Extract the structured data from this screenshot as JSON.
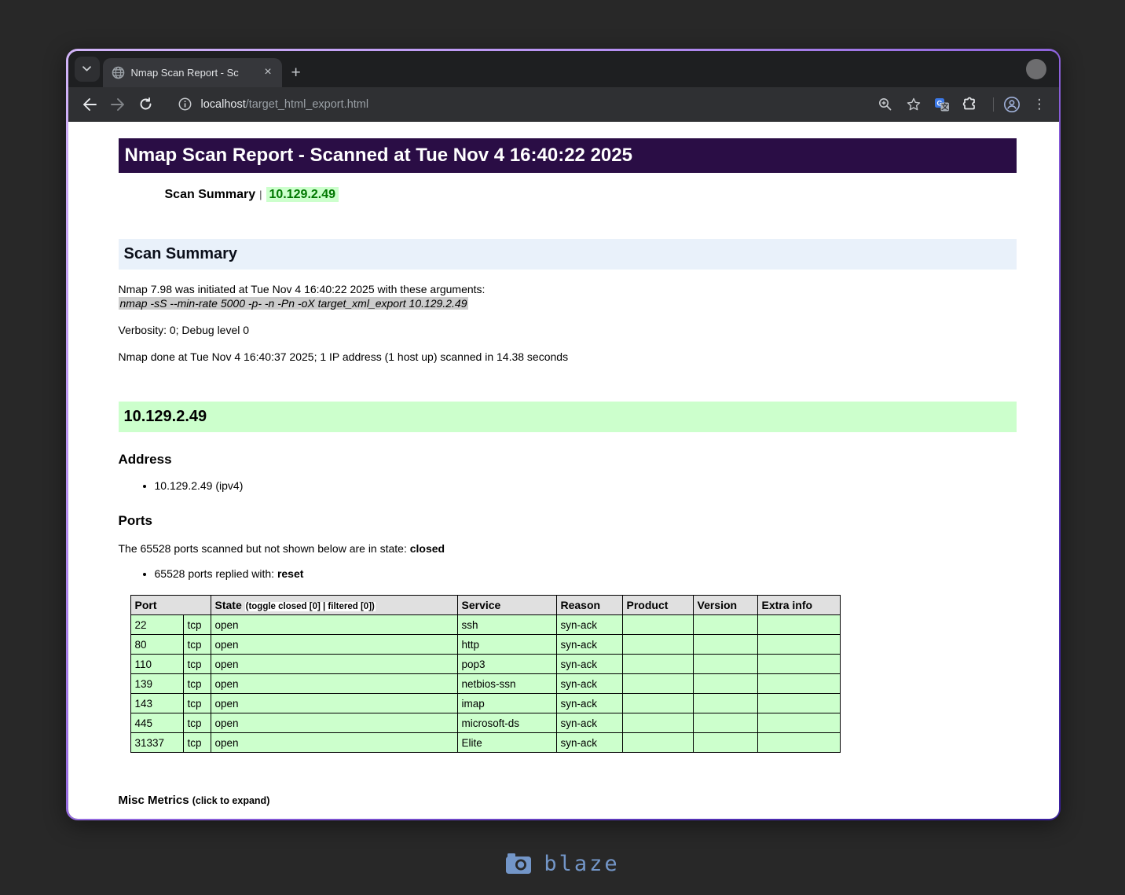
{
  "browser": {
    "tab": {
      "title": "Nmap Scan Report - Sc",
      "close_glyph": "×",
      "new_tab_glyph": "+",
      "kebab_glyph": "⋮"
    },
    "url": {
      "host": "localhost",
      "path": "/target_html_export.html"
    }
  },
  "report": {
    "title": "Nmap Scan Report - Scanned at Tue Nov 4 16:40:22 2025",
    "nav": {
      "summary_link": "Scan Summary",
      "separator": "|",
      "host_link": "10.129.2.49"
    },
    "scan_summary": {
      "heading": "Scan Summary",
      "initiated_line": "Nmap 7.98 was initiated at Tue Nov 4 16:40:22 2025 with these arguments:",
      "command": "nmap -sS --min-rate 5000 -p- -n -Pn -oX target_xml_export 10.129.2.49",
      "verbosity_line": "Verbosity: 0; Debug level 0",
      "done_line": "Nmap done at Tue Nov 4 16:40:37 2025; 1 IP address (1 host up) scanned in 14.38 seconds"
    },
    "host": {
      "heading": "10.129.2.49",
      "address_heading": "Address",
      "addresses": [
        "10.129.2.49 (ipv4)"
      ],
      "ports_heading": "Ports",
      "ports_note_prefix": "The 65528 ports scanned but not shown below are in state: ",
      "ports_note_state": "closed",
      "ports_replied_prefix": "65528 ports replied with: ",
      "ports_replied_value": "reset",
      "table": {
        "headers": {
          "port": "Port",
          "state": "State",
          "state_toggle": "(toggle closed [0] | filtered [0])",
          "service": "Service",
          "reason": "Reason",
          "product": "Product",
          "version": "Version",
          "extra_info": "Extra info"
        },
        "rows": [
          {
            "port": "22",
            "protocol": "tcp",
            "state": "open",
            "service": "ssh",
            "reason": "syn-ack",
            "product": "",
            "version": "",
            "extra": ""
          },
          {
            "port": "80",
            "protocol": "tcp",
            "state": "open",
            "service": "http",
            "reason": "syn-ack",
            "product": "",
            "version": "",
            "extra": ""
          },
          {
            "port": "110",
            "protocol": "tcp",
            "state": "open",
            "service": "pop3",
            "reason": "syn-ack",
            "product": "",
            "version": "",
            "extra": ""
          },
          {
            "port": "139",
            "protocol": "tcp",
            "state": "open",
            "service": "netbios-ssn",
            "reason": "syn-ack",
            "product": "",
            "version": "",
            "extra": ""
          },
          {
            "port": "143",
            "protocol": "tcp",
            "state": "open",
            "service": "imap",
            "reason": "syn-ack",
            "product": "",
            "version": "",
            "extra": ""
          },
          {
            "port": "445",
            "protocol": "tcp",
            "state": "open",
            "service": "microsoft-ds",
            "reason": "syn-ack",
            "product": "",
            "version": "",
            "extra": ""
          },
          {
            "port": "31337",
            "protocol": "tcp",
            "state": "open",
            "service": "Elite",
            "reason": "syn-ack",
            "product": "",
            "version": "",
            "extra": ""
          }
        ]
      },
      "misc_metrics_label": "Misc Metrics",
      "misc_metrics_hint": "(click to expand)"
    }
  },
  "watermark": {
    "label": "blaze"
  },
  "colors": {
    "header_purple": "#2A0D45",
    "section_blue": "#E9F1FA",
    "host_green": "#CCFFCC",
    "link_green": "#007700",
    "command_highlight": "#CCCCCC",
    "table_header_gray": "#E0E0E0",
    "window_border_light": "#CBA6F7",
    "window_border_dark": "#3A1F9E",
    "watermark_blue": "#7396C8"
  }
}
